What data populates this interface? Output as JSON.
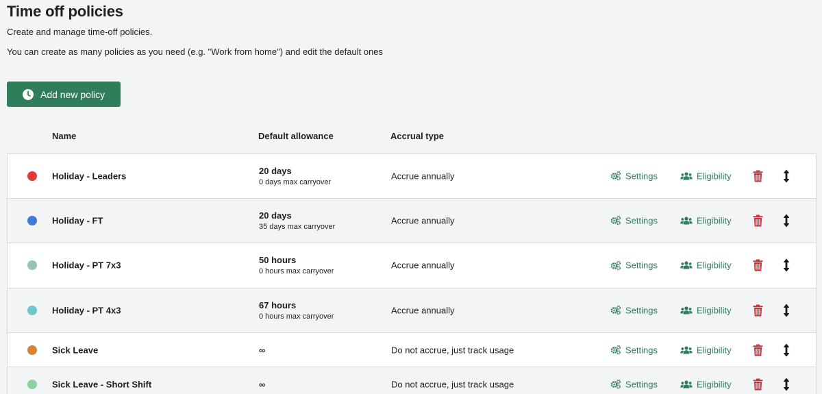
{
  "page": {
    "title": "Time off policies",
    "subtitle": "Create and manage time-off policies.",
    "description": "You can create as many policies as you need (e.g. \"Work from home\") and edit the default ones"
  },
  "add_button": {
    "label": "Add new policy",
    "icon": "clock-icon"
  },
  "columns": {
    "name": "Name",
    "allowance": "Default allowance",
    "accrual": "Accrual type"
  },
  "actions": {
    "settings_label": "Settings",
    "settings_icon": "cogs-icon",
    "eligibility_label": "Eligibility",
    "eligibility_icon": "users-icon",
    "delete_icon": "trash-icon",
    "reorder_icon": "vertical-arrows-icon"
  },
  "colors": {
    "accent": "#2f7d5a",
    "danger": "#c5383f"
  },
  "policies": [
    {
      "color": "#e53935",
      "name": "Holiday - Leaders",
      "allowance": "20 days",
      "carryover": "0 days max carryover",
      "accrual": "Accrue annually"
    },
    {
      "color": "#3f7bd4",
      "name": "Holiday - FT",
      "allowance": "20 days",
      "carryover": "35 days max carryover",
      "accrual": "Accrue annually"
    },
    {
      "color": "#94c4b2",
      "name": "Holiday - PT 7x3",
      "allowance": "50 hours",
      "carryover": "0 hours max carryover",
      "accrual": "Accrue annually"
    },
    {
      "color": "#6fc7c9",
      "name": "Holiday - PT 4x3",
      "allowance": "67 hours",
      "carryover": "0 hours max carryover",
      "accrual": "Accrue annually"
    },
    {
      "color": "#d4823a",
      "name": "Sick Leave",
      "allowance": "∞",
      "carryover": "",
      "accrual": "Do not accrue, just track usage"
    },
    {
      "color": "#8fd0a2",
      "name": "Sick Leave - Short Shift",
      "allowance": "∞",
      "carryover": "",
      "accrual": "Do not accrue, just track usage"
    }
  ]
}
